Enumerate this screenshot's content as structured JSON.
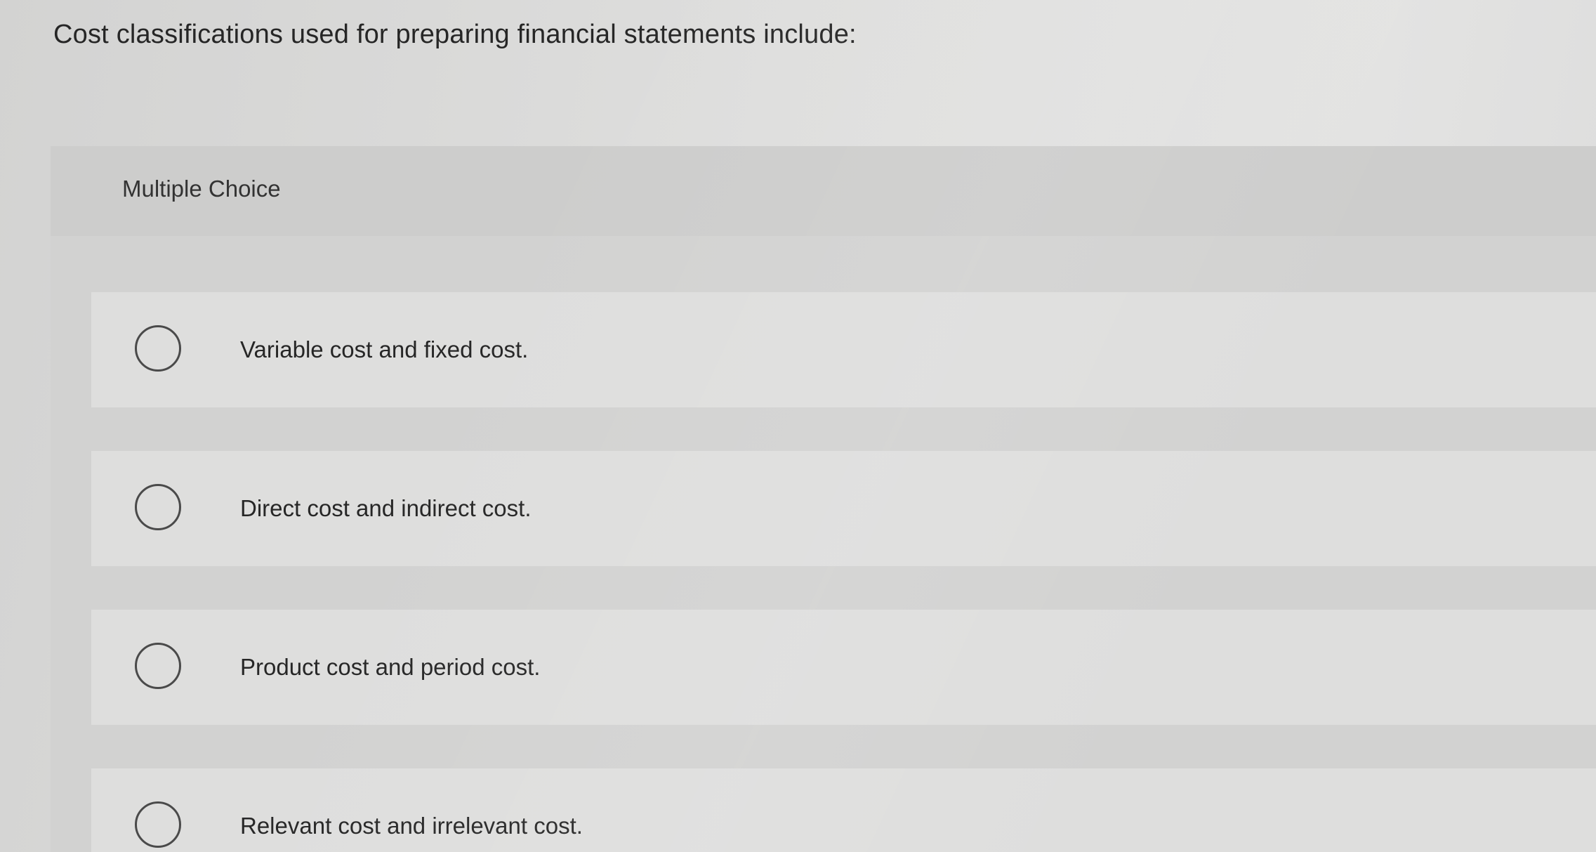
{
  "question": {
    "text": "Cost classifications used for preparing financial statements include:"
  },
  "multiple_choice": {
    "label": "Multiple Choice",
    "selected_index": null,
    "options": [
      {
        "label": "Variable cost and fixed cost."
      },
      {
        "label": "Direct cost and indirect cost."
      },
      {
        "label": "Product cost and period cost."
      },
      {
        "label": "Relevant cost and irrelevant cost."
      }
    ]
  },
  "icons": {
    "radio": "radio-unselected-icon"
  }
}
